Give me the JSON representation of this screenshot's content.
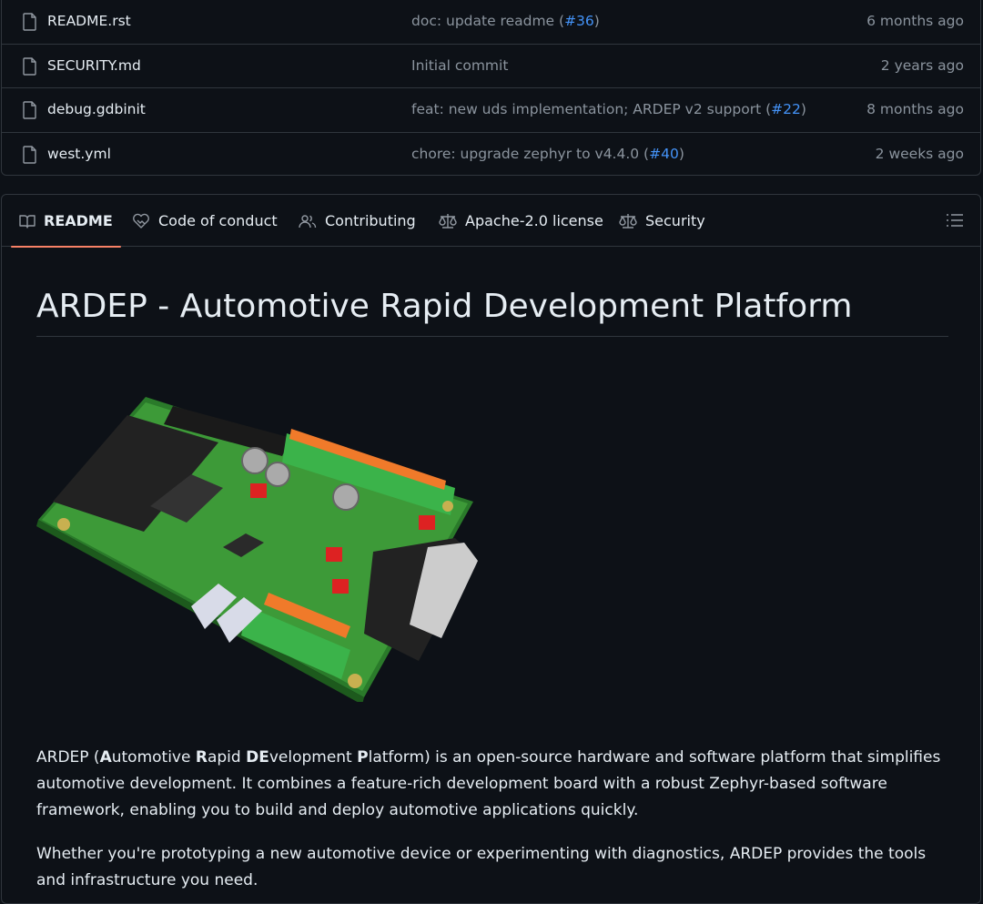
{
  "files": [
    {
      "name": "README.rst",
      "msg_prefix": "doc: update readme (",
      "pr": "#36",
      "msg_suffix": ")",
      "time": "6 months ago"
    },
    {
      "name": "SECURITY.md",
      "msg_prefix": "Initial commit",
      "pr": "",
      "msg_suffix": "",
      "time": "2 years ago"
    },
    {
      "name": "debug.gdbinit",
      "msg_prefix": "feat: new uds implementation; ARDEP v2 support (",
      "pr": "#22",
      "msg_suffix": ")",
      "time": "8 months ago"
    },
    {
      "name": "west.yml",
      "msg_prefix": "chore: upgrade zephyr to v4.4.0 (",
      "pr": "#40",
      "msg_suffix": ")",
      "time": "2 weeks ago"
    }
  ],
  "tabs": [
    {
      "label": "README",
      "icon": "book-icon"
    },
    {
      "label": "Code of conduct",
      "icon": "heart-handshake-icon"
    },
    {
      "label": "Contributing",
      "icon": "people-icon"
    },
    {
      "label": "Apache-2.0 license",
      "icon": "law-scale-icon"
    },
    {
      "label": "Security",
      "icon": "law-scale-icon"
    }
  ],
  "readme": {
    "title": "ARDEP - Automotive Rapid Development Platform",
    "image_alt": "ARDEP board render",
    "p1": {
      "a": "ARDEP (",
      "b1": "A",
      "c1": "utomotive ",
      "b2": "R",
      "c2": "apid ",
      "b3": "DE",
      "c3": "velopment ",
      "b4": "P",
      "c4": "latform",
      "rest": ") is an open-source hardware and software platform that simplifies automotive development. It combines a feature-rich development board with a robust Zephyr-based software framework, enabling you to build and deploy automotive applications quickly."
    },
    "p2": "Whether you're prototyping a new automotive device or experimenting with diagnostics, ARDEP provides the tools and infrastructure you need."
  },
  "colors": {
    "background": "#0d1117",
    "border": "#30363d",
    "link": "#4493f8",
    "muted": "#8b949e",
    "tab_underline": "#f78166"
  }
}
